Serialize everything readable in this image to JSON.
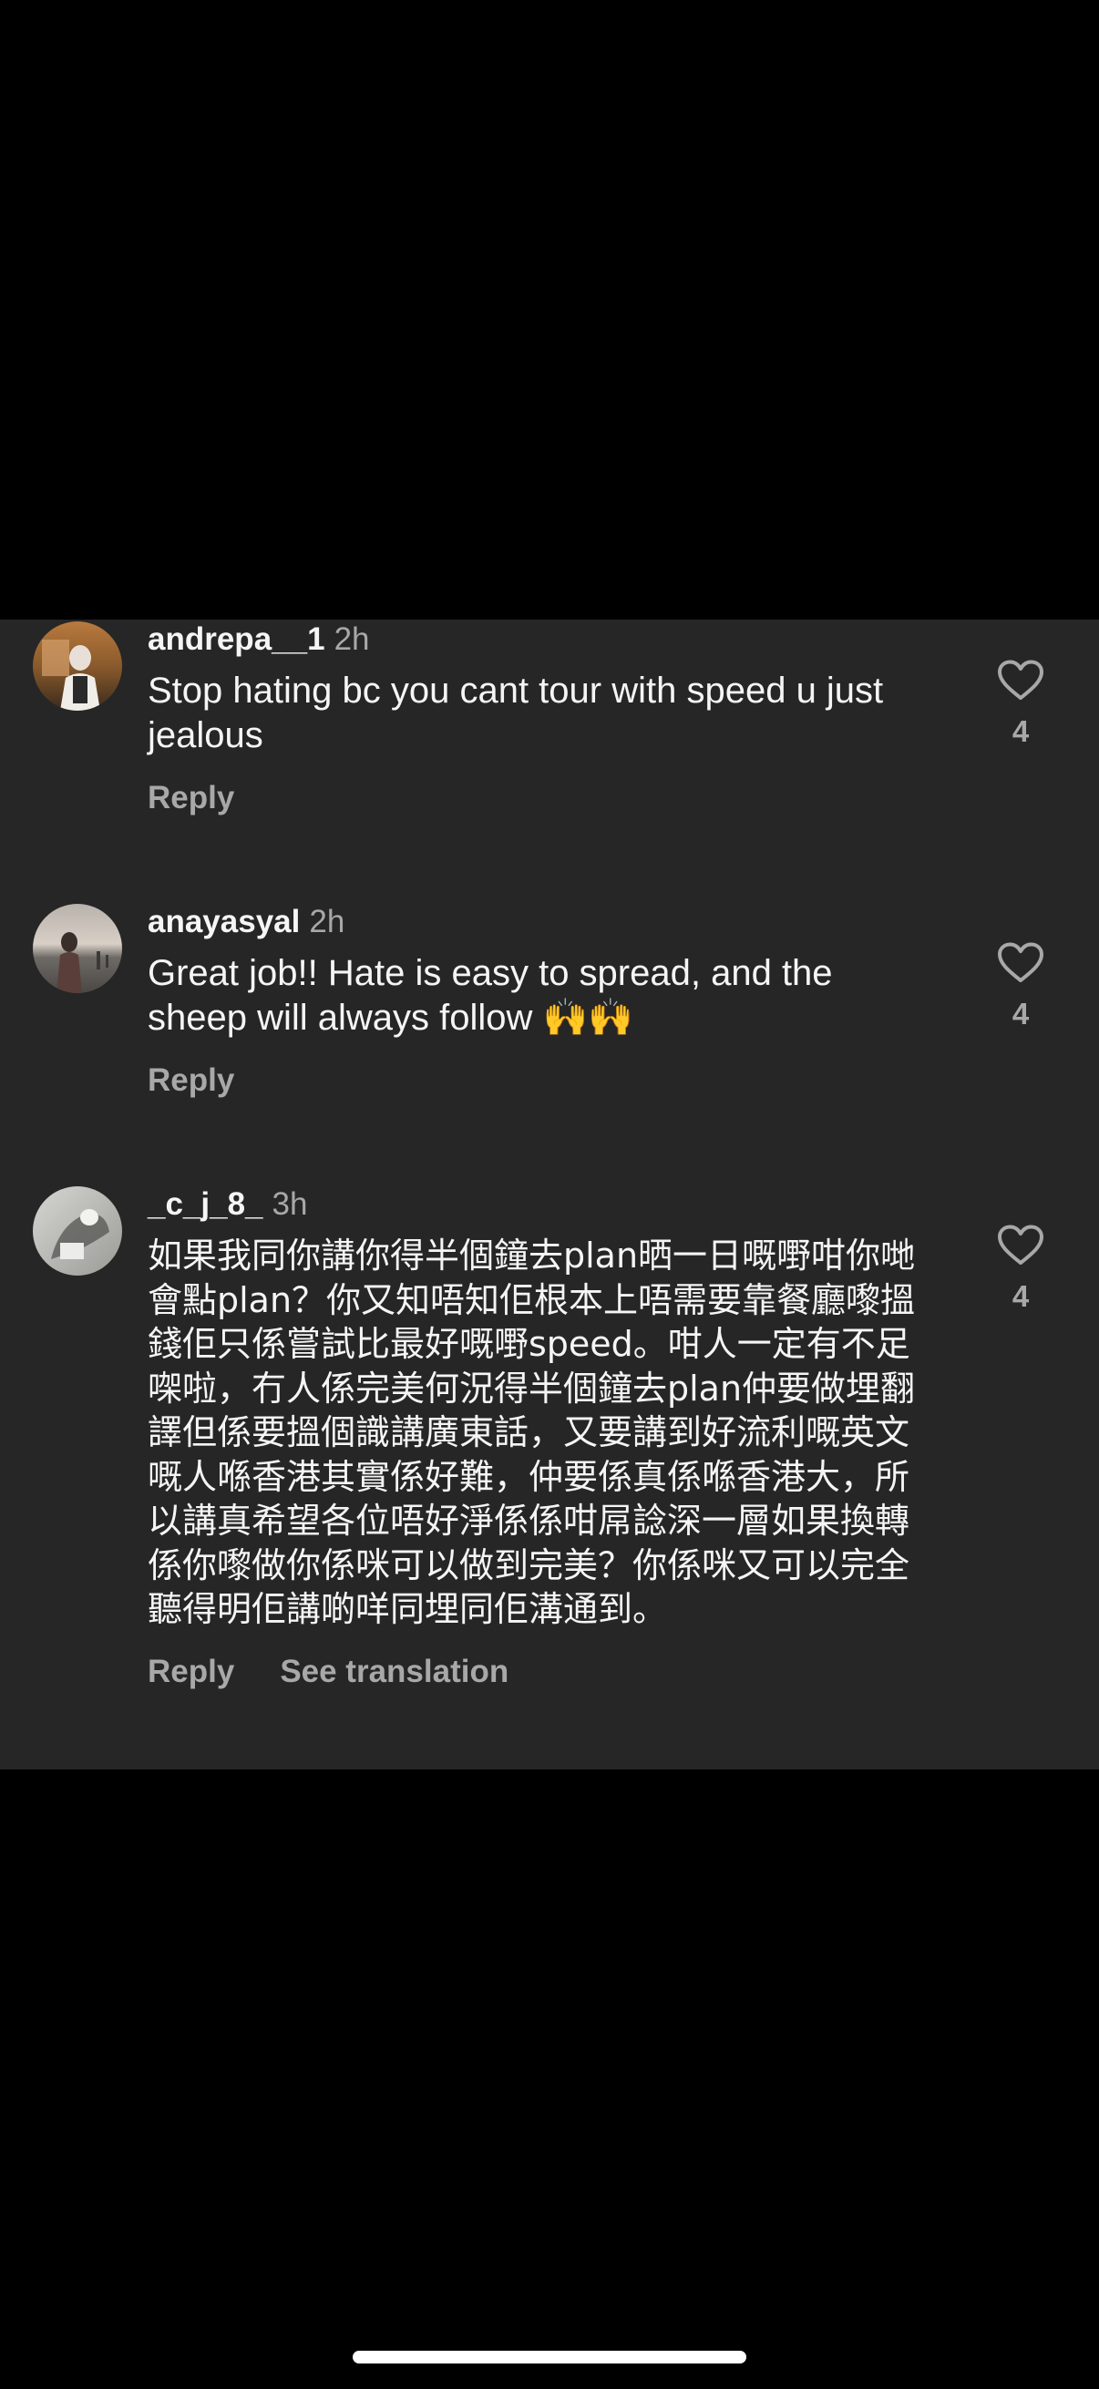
{
  "comments": [
    {
      "username": "andrepa__1",
      "time": "2h",
      "text": "Stop hating bc you cant tour with speed u just jealous",
      "reply_label": "Reply",
      "like_count": "4",
      "avatar_icon": "avatar-photo"
    },
    {
      "username": "anayasyal",
      "time": "2h",
      "text": "Great job!! Hate is easy to spread, and the sheep will always follow 🙌🙌",
      "reply_label": "Reply",
      "like_count": "4",
      "avatar_icon": "avatar-photo"
    },
    {
      "username": "_c_j_8_",
      "time": "3h",
      "text": "如果我同你講你得半個鐘去plan晒一日嘅嘢咁你哋會點plan？你又知唔知佢根本上唔需要靠餐廳嚟搵錢佢只係嘗試比最好嘅嘢speed。咁人一定有不足㗎啦，冇人係完美何況得半個鐘去plan仲要做埋翻譯但係要搵個識講廣東話，又要講到好流利嘅英文嘅人喺香港其實係好難，仲要係真係喺香港大，所以講真希望各位唔好淨係係咁屌諗深一層如果換轉係你嚟做你係咪可以做到完美？你係咪又可以完全聽得明佢講啲咩同埋同佢溝通到。",
      "reply_label": "Reply",
      "see_translation_label": "See translation",
      "like_count": "4",
      "avatar_icon": "avatar-photo"
    }
  ],
  "icons": {
    "like": "heart-outline-icon"
  },
  "colors": {
    "background": "#000000",
    "panel": "#262626",
    "primary_text": "#f5f5f5",
    "secondary_text": "#a8a8a8"
  }
}
